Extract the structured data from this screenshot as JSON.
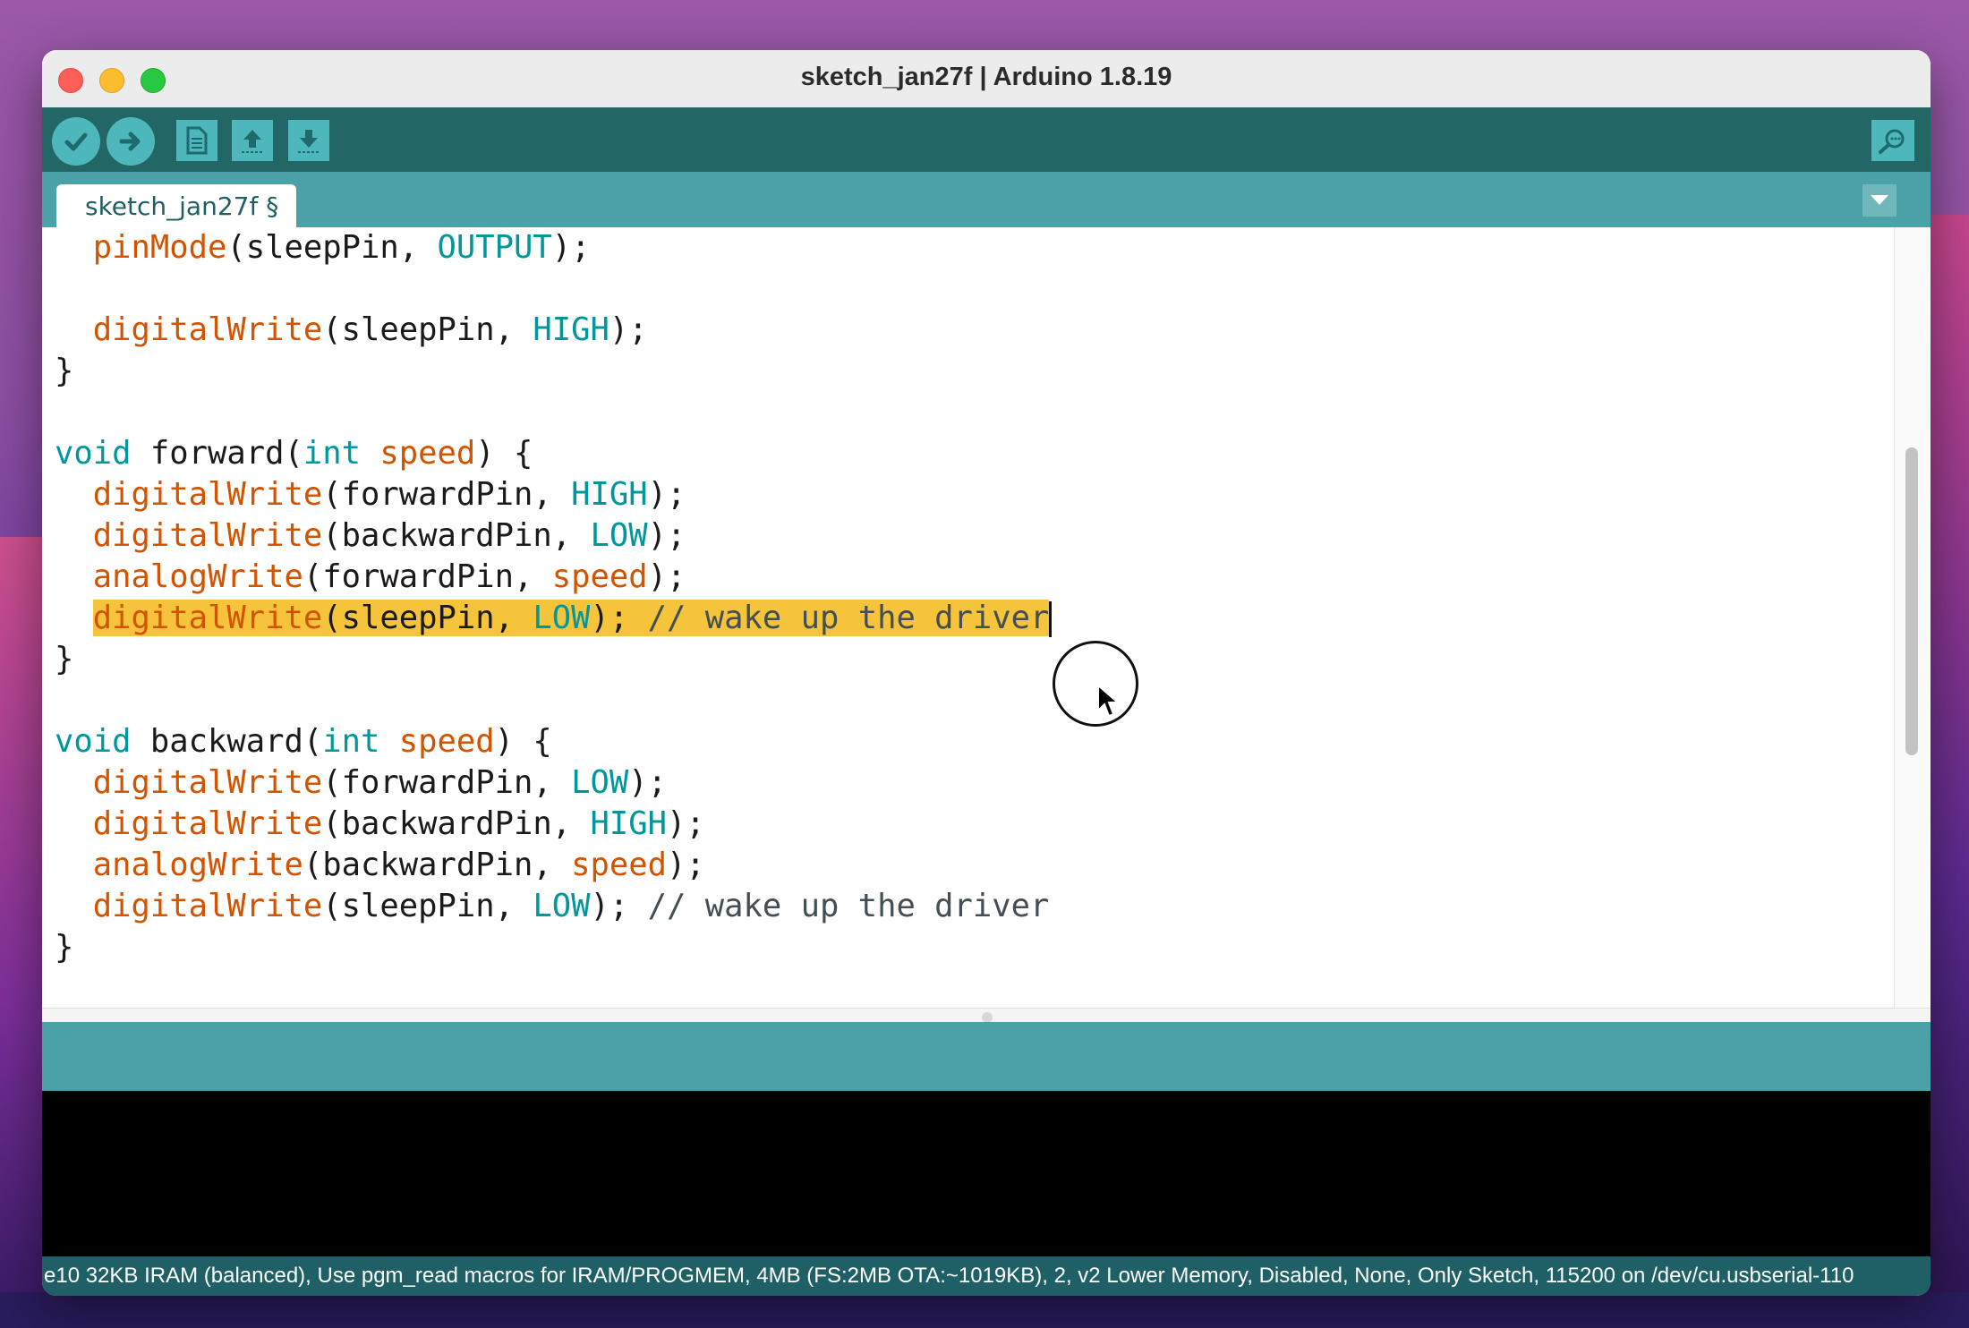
{
  "window": {
    "title": "sketch_jan27f | Arduino 1.8.19"
  },
  "toolbar": {
    "verify": "verify-icon",
    "upload": "upload-icon",
    "new": "new-sketch-icon",
    "open": "open-icon",
    "save": "save-icon",
    "serial_monitor": "serial-monitor-icon"
  },
  "tabs": [
    {
      "label": "sketch_jan27f §"
    }
  ],
  "editor": {
    "lines": [
      [
        [
          "fn",
          "  pinMode"
        ],
        [
          "txt",
          "(sleepPin, "
        ],
        [
          "const",
          "OUTPUT"
        ],
        [
          "txt",
          ");"
        ]
      ],
      [],
      [
        [
          "fn",
          "  digitalWrite"
        ],
        [
          "txt",
          "(sleepPin, "
        ],
        [
          "const",
          "HIGH"
        ],
        [
          "txt",
          ");"
        ]
      ],
      [
        [
          "txt",
          "}"
        ]
      ],
      [],
      [
        [
          "type",
          "void"
        ],
        [
          "txt",
          " forward("
        ],
        [
          "type",
          "int"
        ],
        [
          "txt",
          " "
        ],
        [
          "fn",
          "speed"
        ],
        [
          "txt",
          ") {"
        ]
      ],
      [
        [
          "fn",
          "  digitalWrite"
        ],
        [
          "txt",
          "(forwardPin, "
        ],
        [
          "const",
          "HIGH"
        ],
        [
          "txt",
          ");"
        ]
      ],
      [
        [
          "fn",
          "  digitalWrite"
        ],
        [
          "txt",
          "(backwardPin, "
        ],
        [
          "const",
          "LOW"
        ],
        [
          "txt",
          ");"
        ]
      ],
      [
        [
          "fn",
          "  analogWrite"
        ],
        [
          "txt",
          "(forwardPin, "
        ],
        [
          "fn",
          "speed"
        ],
        [
          "txt",
          ");"
        ]
      ],
      [
        [
          "txt",
          "  "
        ],
        [
          "hlfn",
          "digitalWrite"
        ],
        [
          "hltxt",
          "(sleepPin, "
        ],
        [
          "hlconst",
          "LOW"
        ],
        [
          "hltxt",
          "); "
        ],
        [
          "hlcmt",
          "// wake up the driver"
        ]
      ],
      [
        [
          "txt",
          "}"
        ]
      ],
      [],
      [
        [
          "type",
          "void"
        ],
        [
          "txt",
          " backward("
        ],
        [
          "type",
          "int"
        ],
        [
          "txt",
          " "
        ],
        [
          "fn",
          "speed"
        ],
        [
          "txt",
          ") {"
        ]
      ],
      [
        [
          "fn",
          "  digitalWrite"
        ],
        [
          "txt",
          "(forwardPin, "
        ],
        [
          "const",
          "LOW"
        ],
        [
          "txt",
          ");"
        ]
      ],
      [
        [
          "fn",
          "  digitalWrite"
        ],
        [
          "txt",
          "(backwardPin, "
        ],
        [
          "const",
          "HIGH"
        ],
        [
          "txt",
          ");"
        ]
      ],
      [
        [
          "fn",
          "  analogWrite"
        ],
        [
          "txt",
          "(backwardPin, "
        ],
        [
          "fn",
          "speed"
        ],
        [
          "txt",
          ");"
        ]
      ],
      [
        [
          "fn",
          "  digitalWrite"
        ],
        [
          "txt",
          "(sleepPin, "
        ],
        [
          "const",
          "LOW"
        ],
        [
          "txt",
          "); "
        ],
        [
          "cmt",
          "// wake up the driver"
        ]
      ],
      [
        [
          "txt",
          "}"
        ]
      ]
    ]
  },
  "footer": {
    "board_info": "e10 32KB IRAM (balanced), Use pgm_read macros for IRAM/PROGMEM, 4MB (FS:2MB OTA:~1019KB), 2, v2 Lower Memory, Disabled, None, Only Sketch, 115200 on /dev/cu.usbserial-110"
  },
  "colors": {
    "toolbar_bg": "#226666",
    "tabbar_bg": "#4aa1a7",
    "function": "#d35400",
    "keyword": "#00979c",
    "highlight": "#f5c43a"
  }
}
